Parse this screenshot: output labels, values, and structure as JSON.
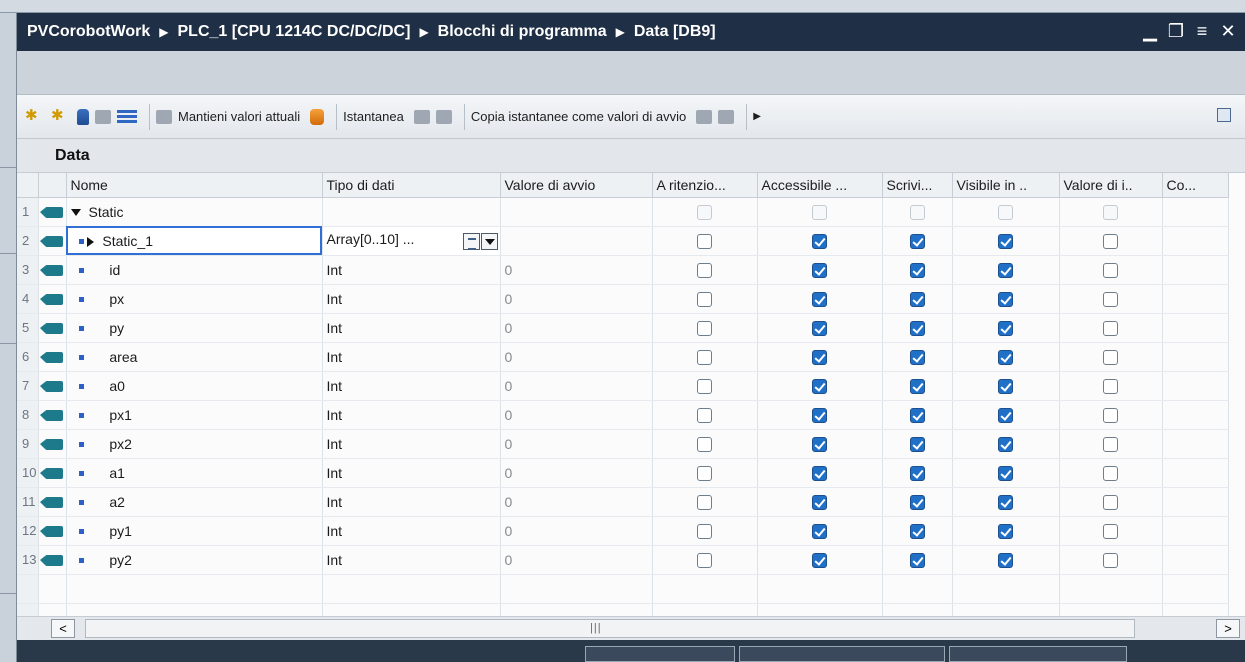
{
  "title_bar": {
    "crumbs": [
      "PVCorobotWork",
      "PLC_1 [CPU 1214C DC/DC/DC]",
      "Blocchi di programma",
      "Data [DB9]"
    ],
    "separator": "▶",
    "controls": {
      "minimize": "▁",
      "restore": "❐",
      "menu": "≡",
      "close": "✕"
    }
  },
  "toolbar": {
    "keep_values_label": "Mantieni valori attuali",
    "snapshot_label": "Istantanea",
    "copy_snapshots_label": "Copia istantanee come valori di avvio",
    "icons": [
      "insert-row-icon",
      "add-row-icon",
      "db-icon",
      "edit-db-icon",
      "list-icon",
      "monitor-icon",
      "keep-values-icon",
      "snapshot-load-icon",
      "snapshot-save-icon",
      "copy-snapshot-icon",
      "copy-snapshot-2-icon",
      "more-icon",
      "settings-icon"
    ]
  },
  "db_title": "Data",
  "table": {
    "columns": [
      "Nome",
      "Tipo di dati",
      "Valore di avvio",
      "A ritenzio...",
      "Accessibile ...",
      "Scrivi...",
      "Visibile in ..",
      "Valore di i..",
      "Co..."
    ],
    "rows": [
      {
        "num": "1",
        "name": "Static",
        "type": "",
        "start": "",
        "expand": "down",
        "bullet": false,
        "checks": [
          "dis",
          "dis",
          "dis",
          "dis",
          "dis"
        ]
      },
      {
        "num": "2",
        "name": "Static_1",
        "type": "Array[0..10] ...",
        "start": "",
        "expand": "right",
        "bullet": true,
        "selected": true,
        "checks": [
          "off",
          "on",
          "on",
          "on",
          "off"
        ]
      },
      {
        "num": "3",
        "name": "id",
        "type": "Int",
        "start": "0",
        "bullet": true,
        "checks": [
          "off",
          "on",
          "on",
          "on",
          "off"
        ]
      },
      {
        "num": "4",
        "name": "px",
        "type": "Int",
        "start": "0",
        "bullet": true,
        "checks": [
          "off",
          "on",
          "on",
          "on",
          "off"
        ]
      },
      {
        "num": "5",
        "name": "py",
        "type": "Int",
        "start": "0",
        "bullet": true,
        "checks": [
          "off",
          "on",
          "on",
          "on",
          "off"
        ]
      },
      {
        "num": "6",
        "name": "area",
        "type": "Int",
        "start": "0",
        "bullet": true,
        "checks": [
          "off",
          "on",
          "on",
          "on",
          "off"
        ]
      },
      {
        "num": "7",
        "name": "a0",
        "type": "Int",
        "start": "0",
        "bullet": true,
        "checks": [
          "off",
          "on",
          "on",
          "on",
          "off"
        ]
      },
      {
        "num": "8",
        "name": "px1",
        "type": "Int",
        "start": "0",
        "bullet": true,
        "checks": [
          "off",
          "on",
          "on",
          "on",
          "off"
        ]
      },
      {
        "num": "9",
        "name": "px2",
        "type": "Int",
        "start": "0",
        "bullet": true,
        "checks": [
          "off",
          "on",
          "on",
          "on",
          "off"
        ]
      },
      {
        "num": "10",
        "name": "a1",
        "type": "Int",
        "start": "0",
        "bullet": true,
        "checks": [
          "off",
          "on",
          "on",
          "on",
          "off"
        ]
      },
      {
        "num": "11",
        "name": "a2",
        "type": "Int",
        "start": "0",
        "bullet": true,
        "checks": [
          "off",
          "on",
          "on",
          "on",
          "off"
        ]
      },
      {
        "num": "12",
        "name": "py1",
        "type": "Int",
        "start": "0",
        "bullet": true,
        "checks": [
          "off",
          "on",
          "on",
          "on",
          "off"
        ]
      },
      {
        "num": "13",
        "name": "py2",
        "type": "Int",
        "start": "0",
        "bullet": true,
        "checks": [
          "off",
          "on",
          "on",
          "on",
          "off"
        ]
      }
    ]
  },
  "scrollbar": {
    "left": "<",
    "right": ">",
    "thumb": "|||"
  },
  "colors": {
    "title_bar": "#1f2f45",
    "checkbox_on": "#2170c8",
    "selection": "#2f6fd6",
    "tag": "#1d7a8a"
  }
}
